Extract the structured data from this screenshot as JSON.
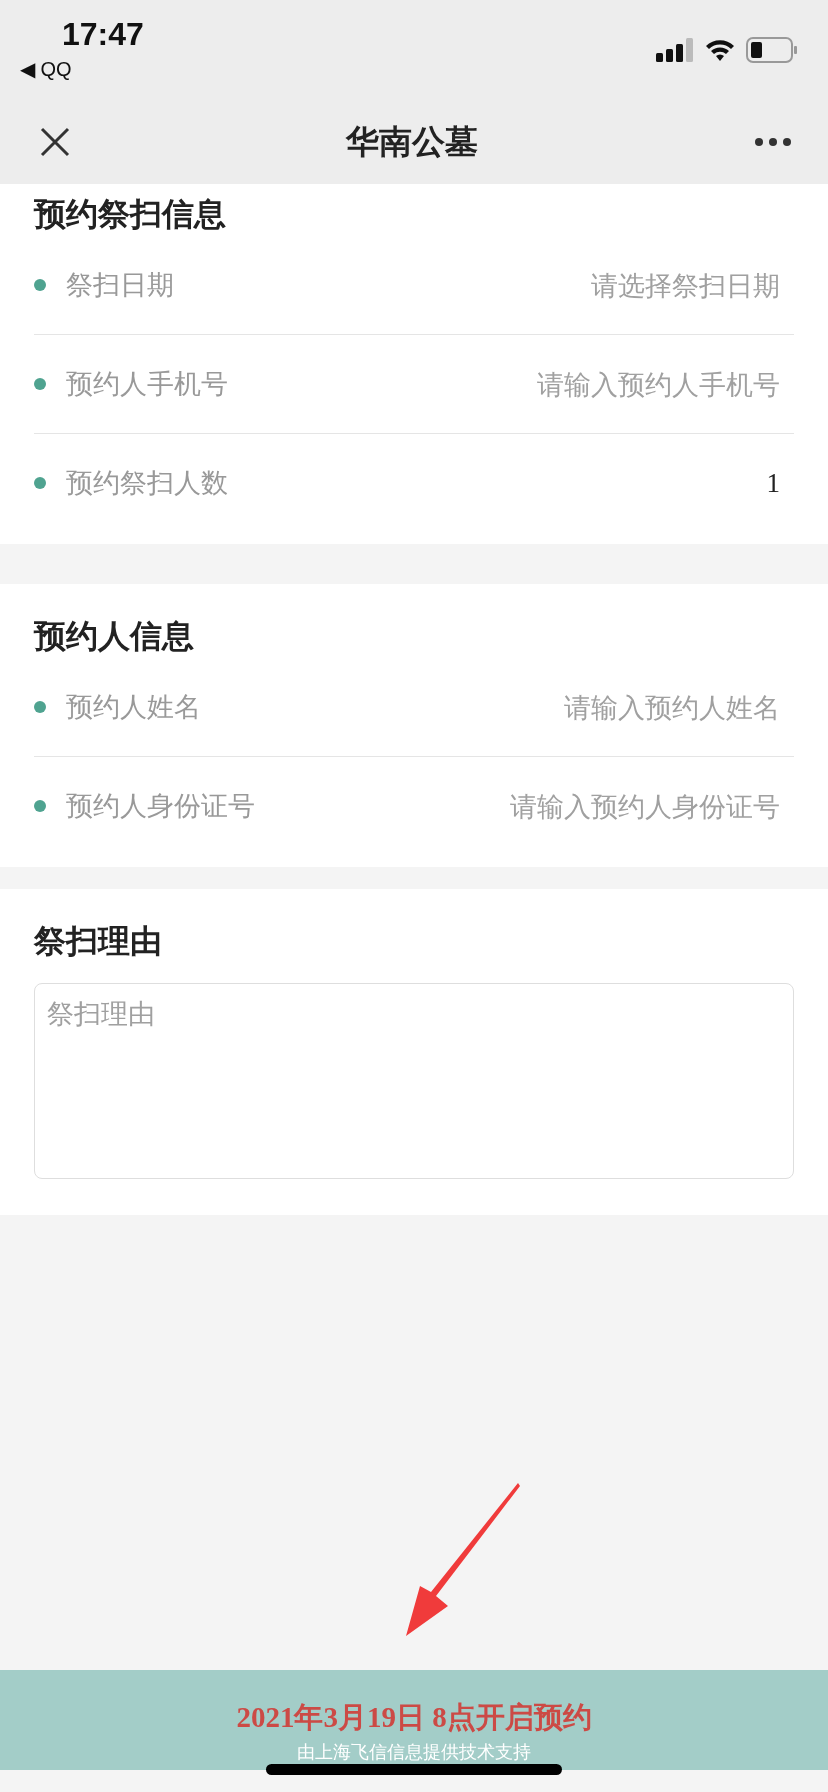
{
  "status_bar": {
    "time": "17:47",
    "back_app": "◀ QQ"
  },
  "nav_bar": {
    "title": "华南公墓"
  },
  "sections": [
    {
      "title": "预约祭扫信息",
      "rows": [
        {
          "label": "祭扫日期",
          "placeholder": "请选择祭扫日期"
        },
        {
          "label": "预约人手机号",
          "placeholder": "请输入预约人手机号"
        },
        {
          "label": "预约祭扫人数",
          "value": "1"
        }
      ]
    },
    {
      "title": "预约人信息",
      "rows": [
        {
          "label": "预约人姓名",
          "placeholder": "请输入预约人姓名"
        },
        {
          "label": "预约人身份证号",
          "placeholder": "请输入预约人身份证号"
        }
      ]
    },
    {
      "title": "祭扫理由",
      "textarea": {
        "placeholder": "祭扫理由"
      }
    }
  ],
  "footer": {
    "notice": "2021年3月19日 8点开启预约",
    "credit": "由上海飞信信息提供技术支持"
  }
}
